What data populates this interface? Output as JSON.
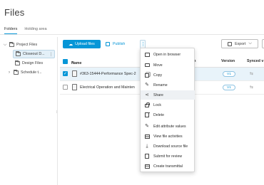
{
  "page": {
    "title": "Files"
  },
  "tabs": [
    {
      "label": "Folders",
      "active": true
    },
    {
      "label": "Holding area",
      "active": false
    }
  ],
  "tree": {
    "root": "Project Files",
    "items": [
      {
        "label": "Closeout D...",
        "selected": true
      },
      {
        "label": "Design Files",
        "selected": false
      },
      {
        "label": "Schedule t...",
        "selected": false
      }
    ]
  },
  "toolbar": {
    "upload_label": "Upload files",
    "publish_label": "Publish",
    "export_label": "Export"
  },
  "table": {
    "columns": {
      "name": "Name",
      "version": "Version",
      "synced": "Synced v"
    },
    "rows": [
      {
        "name": "#363-15444-Performance Spec-2",
        "version": "V1",
        "selected": true
      },
      {
        "name": "Electrical Operation and Mainten",
        "version": "V1",
        "selected": false
      }
    ]
  },
  "context_menu": {
    "items": [
      {
        "label": "Open in browser",
        "icon": "browser-icon"
      },
      {
        "label": "Move",
        "icon": "folder-icon"
      },
      {
        "label": "Copy",
        "icon": "copy-icon"
      },
      {
        "label": "Rename",
        "icon": "pencil-icon"
      },
      {
        "label": "Share",
        "icon": "share-icon",
        "hover": true
      },
      {
        "label": "Lock",
        "icon": "lock-icon"
      },
      {
        "label": "Delete",
        "icon": "trash-icon"
      },
      {
        "label": "Edit attribute values",
        "icon": "pencil-icon"
      },
      {
        "label": "View file activities",
        "icon": "list-icon"
      },
      {
        "label": "Download source file",
        "icon": "download-icon"
      },
      {
        "label": "Submit for review",
        "icon": "review-icon"
      },
      {
        "label": "Create transmittal",
        "icon": "transmittal-icon"
      }
    ]
  },
  "colors": {
    "accent": "#0696d7",
    "selected_row": "#e8f3fa",
    "hover_item": "#eef1f4"
  }
}
